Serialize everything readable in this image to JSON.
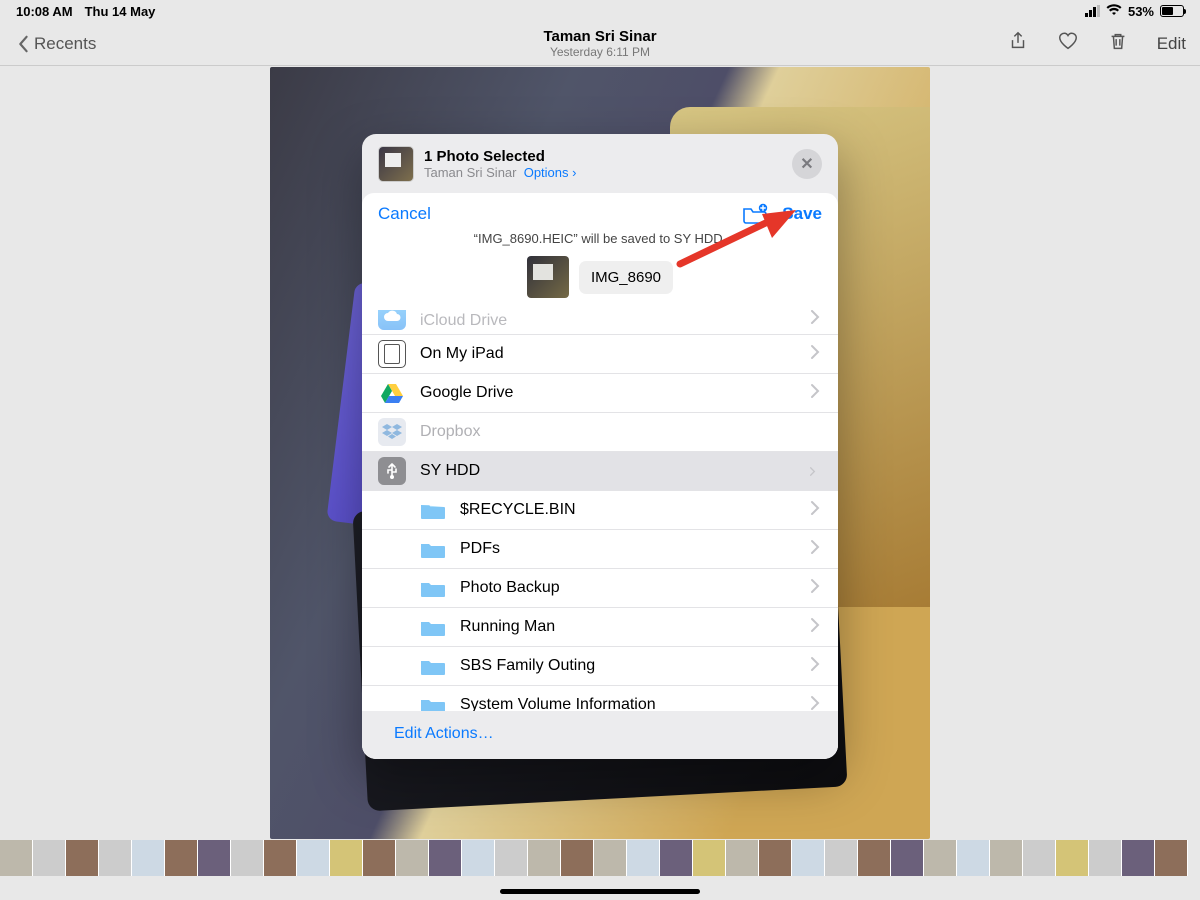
{
  "status": {
    "time": "10:08 AM",
    "date": "Thu 14 May",
    "battery_pct": "53%"
  },
  "nav": {
    "back_label": "Recents",
    "title": "Taman Sri Sinar",
    "subtitle": "Yesterday  6:11 PM",
    "edit_label": "Edit"
  },
  "sheet": {
    "title": "1 Photo Selected",
    "subtitle_location": "Taman Sri Sinar",
    "options_label": "Options",
    "cancel_label": "Cancel",
    "save_label": "Save",
    "save_message": "“IMG_8690.HEIC” will be saved to SY HDD.",
    "filename_value": "IMG_8690",
    "edit_actions_label": "Edit Actions…"
  },
  "locations": [
    {
      "id": "icloud",
      "label": "iCloud Drive",
      "enabled": true,
      "selected": false
    },
    {
      "id": "ipad",
      "label": "On My iPad",
      "enabled": true,
      "selected": false
    },
    {
      "id": "gdrive",
      "label": "Google Drive",
      "enabled": true,
      "selected": false
    },
    {
      "id": "dropbox",
      "label": "Dropbox",
      "enabled": false,
      "selected": false
    },
    {
      "id": "syhdd",
      "label": "SY HDD",
      "enabled": true,
      "selected": true
    }
  ],
  "syhdd_folders": [
    {
      "label": "$RECYCLE.BIN"
    },
    {
      "label": "PDFs"
    },
    {
      "label": "Photo Backup"
    },
    {
      "label": "Running Man"
    },
    {
      "label": "SBS Family Outing"
    },
    {
      "label": "System Volume Information"
    }
  ]
}
